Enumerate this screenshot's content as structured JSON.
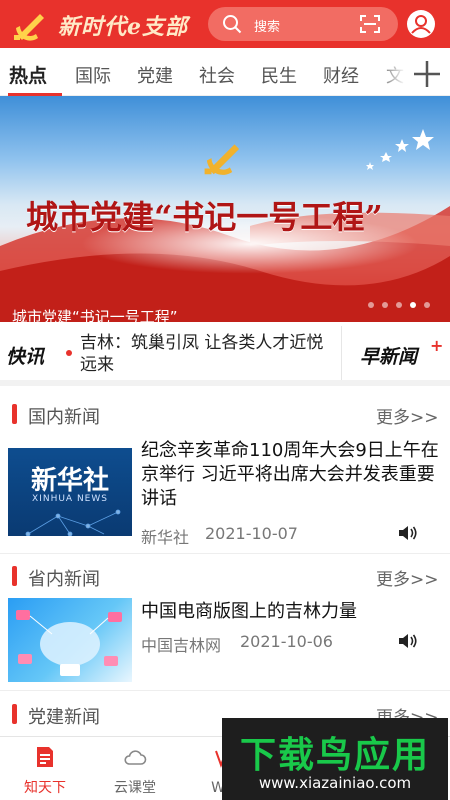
{
  "header": {
    "app_title": "新时代e支部",
    "search_placeholder": "搜索"
  },
  "tabs": [
    {
      "label": "热点",
      "active": true
    },
    {
      "label": "国际"
    },
    {
      "label": "党建"
    },
    {
      "label": "社会"
    },
    {
      "label": "民生"
    },
    {
      "label": "财经"
    },
    {
      "label": "文"
    }
  ],
  "banner": {
    "headline": "城市党建“书记一号工程”",
    "caption": "城市党建“书记一号工程”",
    "slide_count": 5,
    "active_slide": 4
  },
  "express": {
    "label": "快讯",
    "text": "吉林：筑巢引凤 让各类人才近悦远来",
    "morning_label": "早新闻",
    "morning_plus": "+"
  },
  "sections": [
    {
      "title": "国内新闻",
      "more": "更多>>",
      "article": {
        "title": "纪念辛亥革命110周年大会9日上午在京举行 习近平将出席大会并发表重要讲话",
        "source": "新华社",
        "date": "2021-10-07",
        "thumb_text": "新华社",
        "thumb_subtext": "XINHUA NEWS"
      }
    },
    {
      "title": "省内新闻",
      "more": "更多>>",
      "article": {
        "title": "中国电商版图上的吉林力量",
        "source": "中国吉林网",
        "date": "2021-10-06"
      }
    },
    {
      "title": "党建新闻",
      "more": "更多>>"
    }
  ],
  "bottom_nav": [
    {
      "label": "知天下",
      "icon": "document-icon",
      "active": true
    },
    {
      "label": "云课堂",
      "icon": "cloud-icon"
    },
    {
      "label": "W文",
      "icon": "w-icon"
    }
  ],
  "watermark": {
    "title": "下载鸟应用",
    "url": "www.xiazainiao.com"
  },
  "colors": {
    "brand_red": "#e8322c",
    "text_gray": "#777777",
    "watermark_green": "#19c94a"
  }
}
